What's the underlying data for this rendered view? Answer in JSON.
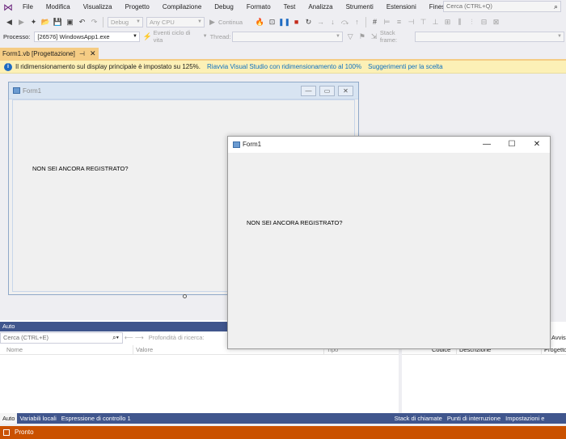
{
  "menu": {
    "items": [
      "File",
      "Modifica",
      "Visualizza",
      "Progetto",
      "Compilazione",
      "Debug",
      "Formato",
      "Test",
      "Analizza",
      "Strumenti",
      "Estensioni",
      "Finestra",
      "?"
    ],
    "search_placeholder": "Cerca (CTRL+Q)"
  },
  "toolbar1": {
    "config": "Debug",
    "platform": "Any CPU",
    "continue_label": "Continua"
  },
  "toolbar2": {
    "process_label": "Processo:",
    "process_value": "[26576] WindowsApp1.exe",
    "lifecycle_label": "Eventi ciclo di vita",
    "thread_label": "Thread:",
    "stack_label": "Stack frame:"
  },
  "doc_tab": {
    "label": "Form1.vb [Progettazione]",
    "pin": "⊣",
    "close": "✕"
  },
  "infobar": {
    "message": "Il ridimensionamento sul display principale è impostato su 125%.",
    "link1": "Riavvia Visual Studio con ridimensionamento al 100%",
    "link2": "Suggerimenti per la scelta"
  },
  "designer_form": {
    "title": "Form1",
    "label": "NON SEI ANCORA REGISTRATO?"
  },
  "running_form": {
    "title": "Form1",
    "label": "NON SEI ANCORA REGISTRATO?"
  },
  "auto_panel": {
    "title": "Auto",
    "search_placeholder": "Cerca (CTRL+E)",
    "depth_label": "Profondità di ricerca:",
    "columns": [
      "Nome",
      "Valore",
      "Tipo"
    ]
  },
  "error_panel": {
    "columns": [
      "Codice",
      "Descrizione",
      "Progetto"
    ],
    "partial_label": "Avvis"
  },
  "bottom_tabs_left": [
    "Auto",
    "Variabili locali",
    "Espressione di controllo 1"
  ],
  "bottom_tabs_right": [
    "Stack di chiamate",
    "Punti di interruzione",
    "Impostazioni e"
  ],
  "status": {
    "text": "Pronto"
  }
}
